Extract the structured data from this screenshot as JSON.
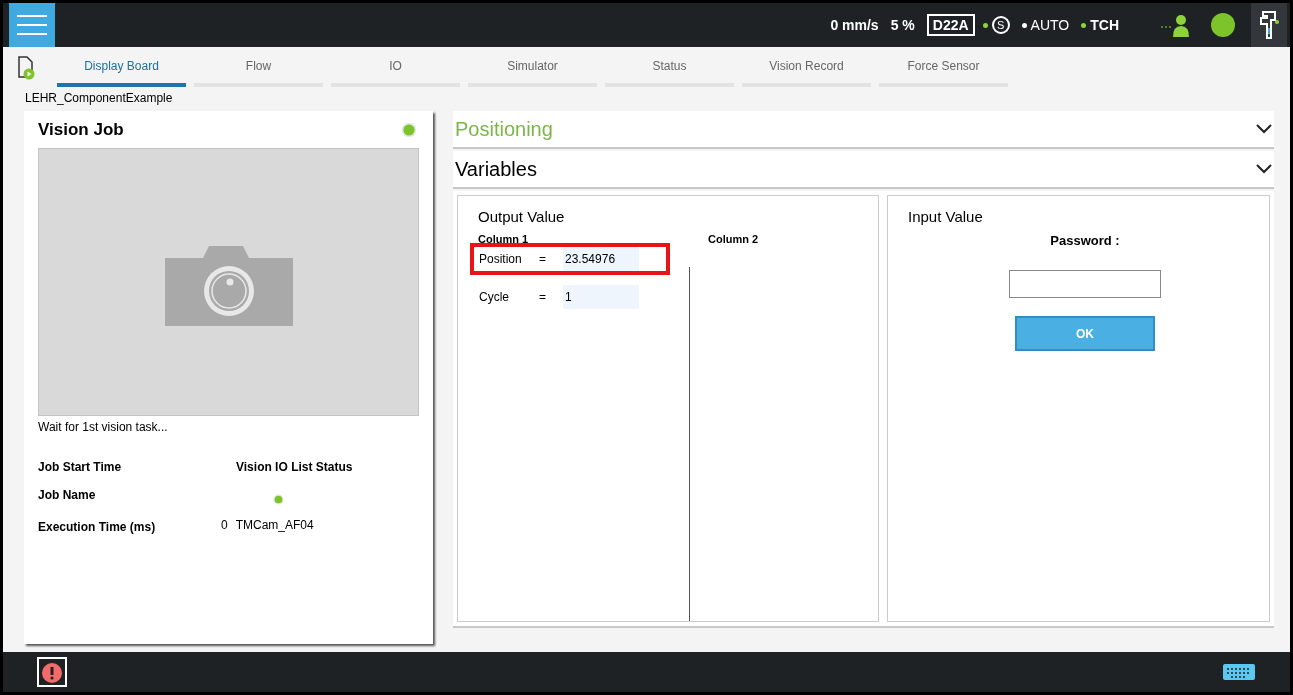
{
  "status_bar": {
    "speed": "0 mm/s",
    "percent": "5 %",
    "code": "D22A",
    "safety": "S",
    "mode": "AUTO",
    "tch": "TCH"
  },
  "tabs": [
    {
      "label": "Display Board",
      "selected": true
    },
    {
      "label": "Flow",
      "selected": false
    },
    {
      "label": "IO",
      "selected": false
    },
    {
      "label": "Simulator",
      "selected": false
    },
    {
      "label": "Status",
      "selected": false
    },
    {
      "label": "Vision Record",
      "selected": false
    },
    {
      "label": "Force Sensor",
      "selected": false
    }
  ],
  "project_name": "LEHR_ComponentExample",
  "vision_job": {
    "title": "Vision Job",
    "message": "Wait for 1st vision task...",
    "labels": [
      "Job Start Time",
      "Job Name",
      "Execution Time (ms)"
    ],
    "execution_time": "0",
    "io_list_title": "Vision IO List Status",
    "camera_name": "TMCam_AF04"
  },
  "sections": [
    {
      "title": "Positioning",
      "highlighted": true
    },
    {
      "title": "Variables",
      "highlighted": false
    }
  ],
  "output": {
    "title": "Output Value",
    "columns": [
      "Column 1",
      "Column 2"
    ],
    "rows": [
      {
        "name": "Position",
        "equals": "=",
        "value": "23.54976",
        "highlighted": true
      },
      {
        "name": "Cycle",
        "equals": "=",
        "value": "1",
        "highlighted": false
      }
    ]
  },
  "input": {
    "title": "Input Value",
    "label": "Password :",
    "button": "OK"
  }
}
